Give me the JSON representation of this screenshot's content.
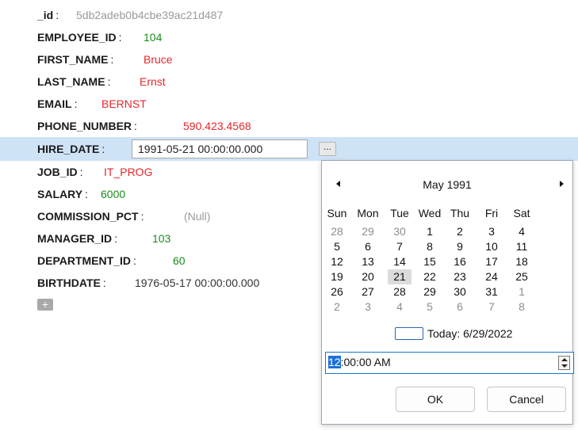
{
  "record": {
    "fields": [
      {
        "key": "_id",
        "value": "5db2adeb0b4cbe39ac21d487",
        "color": "gray"
      },
      {
        "key": "EMPLOYEE_ID",
        "value": "104",
        "color": "green"
      },
      {
        "key": "FIRST_NAME",
        "value": "Bruce",
        "color": "red"
      },
      {
        "key": "LAST_NAME",
        "value": "Ernst",
        "color": "red"
      },
      {
        "key": "EMAIL",
        "value": "BERNST",
        "color": "red"
      },
      {
        "key": "PHONE_NUMBER",
        "value": "590.423.4568",
        "color": "red"
      },
      {
        "key": "HIRE_DATE",
        "value": "1991-05-21 00:00:00.000",
        "color": "dark"
      },
      {
        "key": "JOB_ID",
        "value": "IT_PROG",
        "color": "red"
      },
      {
        "key": "SALARY",
        "value": "6000",
        "color": "green"
      },
      {
        "key": "COMMISSION_PCT",
        "value": "(Null)",
        "color": "gray"
      },
      {
        "key": "MANAGER_ID",
        "value": "103",
        "color": "green"
      },
      {
        "key": "DEPARTMENT_ID",
        "value": "60",
        "color": "green"
      },
      {
        "key": "BIRTHDATE",
        "value": "1976-05-17 00:00:00.000",
        "color": "dark"
      }
    ],
    "separator": ":",
    "editing_field": "HIRE_DATE",
    "ellipsis_label": "...",
    "add_label": "+"
  },
  "calendar": {
    "month_title": "May 1991",
    "weekdays": [
      "Sun",
      "Mon",
      "Tue",
      "Wed",
      "Thu",
      "Fri",
      "Sat"
    ],
    "weeks": [
      [
        "28",
        "29",
        "30",
        "1",
        "2",
        "3",
        "4"
      ],
      [
        "5",
        "6",
        "7",
        "8",
        "9",
        "10",
        "11"
      ],
      [
        "12",
        "13",
        "14",
        "15",
        "16",
        "17",
        "18"
      ],
      [
        "19",
        "20",
        "21",
        "22",
        "23",
        "24",
        "25"
      ],
      [
        "26",
        "27",
        "28",
        "29",
        "30",
        "31",
        "1"
      ],
      [
        "2",
        "3",
        "4",
        "5",
        "6",
        "7",
        "8"
      ]
    ],
    "selected_day": "21",
    "today_label": "Today: 6/29/2022",
    "time_hour": "12",
    "time_rest": ":00:00 AM",
    "ok_label": "OK",
    "cancel_label": "Cancel"
  },
  "colors": {
    "green": "#1a8c1a",
    "red": "#e8262c",
    "gray": "#9a9a9a",
    "selection_row": "#cfe3f7",
    "accent": "#1e6fd9"
  }
}
